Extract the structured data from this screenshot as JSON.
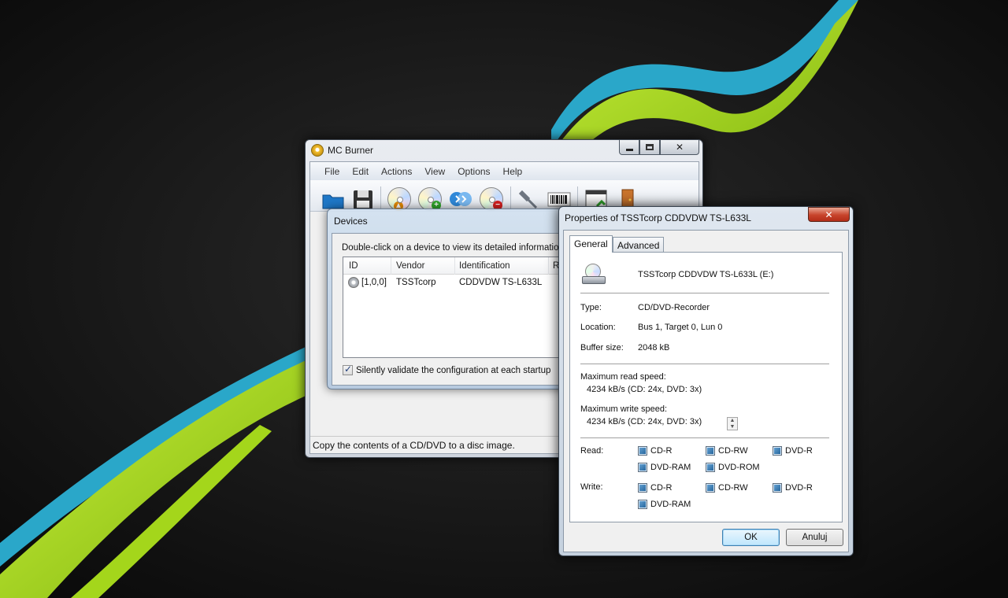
{
  "main_window": {
    "title": "MC Burner",
    "menu": [
      "File",
      "Edit",
      "Actions",
      "View",
      "Options",
      "Help"
    ],
    "status": "Copy the contents of a CD/DVD to a disc image."
  },
  "devices_dialog": {
    "title": "Devices",
    "hint": "Double-click on a device to view its detailed information.",
    "columns": [
      "ID",
      "Vendor",
      "Identification",
      "R"
    ],
    "rows": [
      {
        "id": "[1,0,0]",
        "vendor": "TSSTcorp",
        "identification": "CDDVDW TS-L633L"
      }
    ],
    "validate_label": "Silently validate the configuration at each startup",
    "validate_checked": true
  },
  "properties_dialog": {
    "title": "Properties of TSSTcorp CDDVDW TS-L633L",
    "tabs": [
      "General",
      "Advanced"
    ],
    "active_tab": "General",
    "device_name": "TSSTcorp CDDVDW TS-L633L  (E:)",
    "fields": [
      {
        "label": "Type:",
        "value": "CD/DVD-Recorder"
      },
      {
        "label": "Location:",
        "value": "Bus 1, Target 0, Lun 0"
      },
      {
        "label": "Buffer size:",
        "value": "2048 kB"
      }
    ],
    "max_read_label": "Maximum read speed:",
    "max_read_value": "4234 kB/s (CD: 24x, DVD: 3x)",
    "max_write_label": "Maximum write speed:",
    "max_write_value": "4234 kB/s (CD: 24x, DVD: 3x)",
    "read_label": "Read:",
    "read_caps": [
      "CD-R",
      "CD-RW",
      "DVD-R",
      "DVD-RAM",
      "DVD-ROM"
    ],
    "write_label": "Write:",
    "write_caps": [
      "CD-R",
      "CD-RW",
      "DVD-R",
      "DVD-RAM"
    ],
    "ok_label": "OK",
    "cancel_label": "Anuluj"
  },
  "colors": {
    "accent_green": "#9bd10f",
    "accent_teal": "#2aa7c9",
    "desktop": "#121212"
  }
}
